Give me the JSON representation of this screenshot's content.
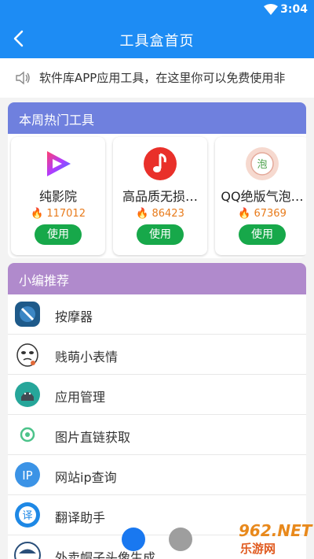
{
  "status_bar": {
    "time": "3:04",
    "icons": [
      "wifi-icon"
    ]
  },
  "app_bar": {
    "title": "工具盒首页",
    "back_icon": "chevron-left-icon"
  },
  "notice": {
    "icon": "speaker-icon",
    "text": "软件库APP应用工具，在这里你可以免费使用非"
  },
  "hot_tools": {
    "title": "本周热门工具",
    "items": [
      {
        "name": "纯影院",
        "count": "117012",
        "button": "使用",
        "icon": "video-play-icon"
      },
      {
        "name": "高品质无损…",
        "count": "86423",
        "button": "使用",
        "icon": "music-note-icon"
      },
      {
        "name": "QQ绝版气泡…",
        "count": "67369",
        "button": "使用",
        "icon": "bubble-icon"
      }
    ]
  },
  "recommend": {
    "title": "小编推荐",
    "items": [
      {
        "name": "按摩器",
        "icon": "massager-icon"
      },
      {
        "name": "贱萌小表情",
        "icon": "emoji-face-icon"
      },
      {
        "name": "应用管理",
        "icon": "android-icon"
      },
      {
        "name": "图片直链获取",
        "icon": "link-icon"
      },
      {
        "name": "网站ip查询",
        "icon": "ip-icon"
      },
      {
        "name": "翻译助手",
        "icon": "translate-icon"
      },
      {
        "name": "外卖帽子头像生成",
        "icon": "avatar-hat-icon"
      }
    ]
  },
  "watermark": {
    "line1": "962.NET",
    "line2": "乐游网"
  },
  "colors": {
    "primary": "#1d8cf4",
    "hot_header": "#6f80de",
    "rec_header": "#b08acc",
    "use_button": "#17a84a",
    "count": "#e87b1c"
  }
}
